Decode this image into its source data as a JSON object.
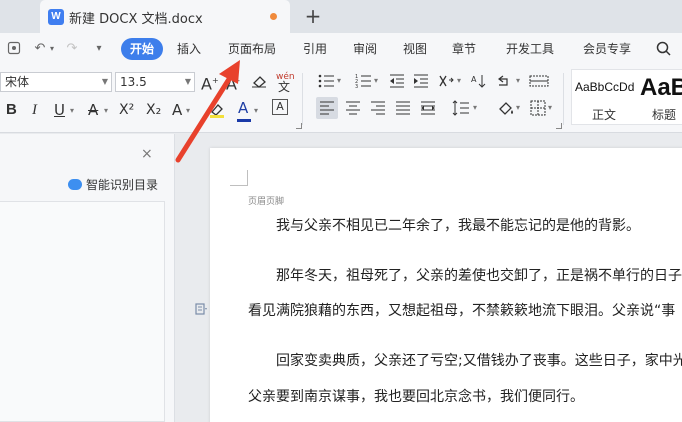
{
  "tab": {
    "app_icon_letter": "W",
    "title": "新建 DOCX 文档.docx",
    "new_tab": "+"
  },
  "quick_access": {
    "undo": "↶",
    "redo": "↷",
    "more": "▾"
  },
  "menu": {
    "items": [
      "开始",
      "插入",
      "页面布局",
      "引用",
      "审阅",
      "视图",
      "章节",
      "开发工具",
      "会员专享"
    ],
    "active_index": 0,
    "search_partial": "Q"
  },
  "ribbon": {
    "font_name": "宋体",
    "font_size": "13.5",
    "format_buttons": [
      "B",
      "I",
      "U",
      "A",
      "X²",
      "X₂",
      "A"
    ],
    "style_gallery": [
      {
        "sample": "AaBbCcDd",
        "name": "正文"
      },
      {
        "sample": "AaB",
        "name": "标题"
      }
    ],
    "pinyin": "wén"
  },
  "nav": {
    "close": "×",
    "smart_toc": "智能识别目录"
  },
  "document": {
    "header_label": "页眉页脚",
    "lines": [
      "我与父亲不相见已二年余了，我最不能忘记的是他的背影。",
      "那年冬天，祖母死了，父亲的差使也交卸了，正是祸不单行的日子",
      "看见满院狼藉的东西，又想起祖母，不禁簌簌地流下眼泪。父亲说“事",
      "回家变卖典质，父亲还了亏空;又借钱办了丧事。这些日子，家中光",
      "父亲要到南京谋事，我也要回北京念书，我们便同行。"
    ]
  },
  "colors": {
    "accent": "#3d7eeb",
    "arrow": "#e8412c",
    "unsaved_dot": "#f08a3c"
  }
}
